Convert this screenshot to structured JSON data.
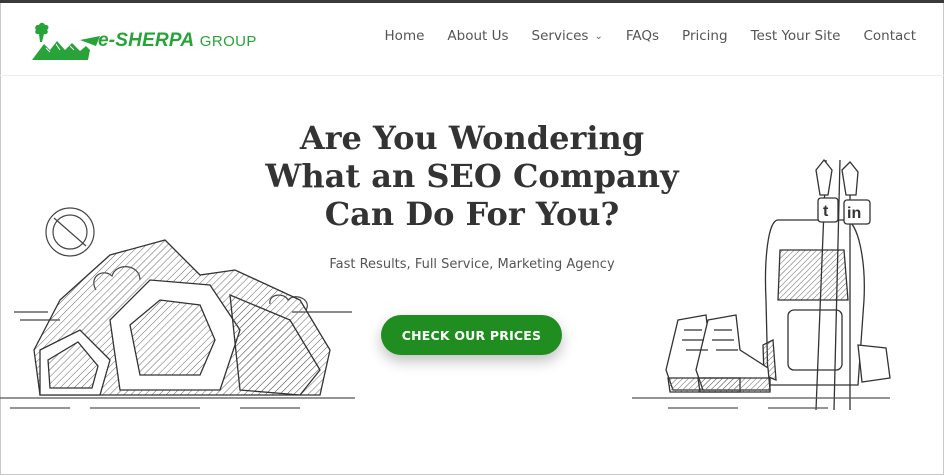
{
  "brand": {
    "name_bold": "e-SHERPA",
    "name_light": "GROUP",
    "accent": "#27a33a"
  },
  "nav": {
    "items": [
      {
        "label": "Home"
      },
      {
        "label": "About Us"
      },
      {
        "label": "Services",
        "has_dropdown": true
      },
      {
        "label": "FAQs"
      },
      {
        "label": "Pricing"
      },
      {
        "label": "Test Your Site"
      },
      {
        "label": "Contact"
      }
    ]
  },
  "hero": {
    "title_line1": "Are You Wondering",
    "title_line2": "What an SEO Company",
    "title_line3": "Can Do For You?",
    "subtitle": "Fast Results, Full Service, Marketing Agency",
    "cta_label": "CHECK OUR PRICES",
    "cta_color": "#1f8d1f"
  },
  "illustration_right": {
    "tag1": "t",
    "tag2": "in"
  },
  "icons": [
    "mountain-logo-icon",
    "chevron-down-icon",
    "rocks-illustration",
    "backpack-illustration"
  ]
}
